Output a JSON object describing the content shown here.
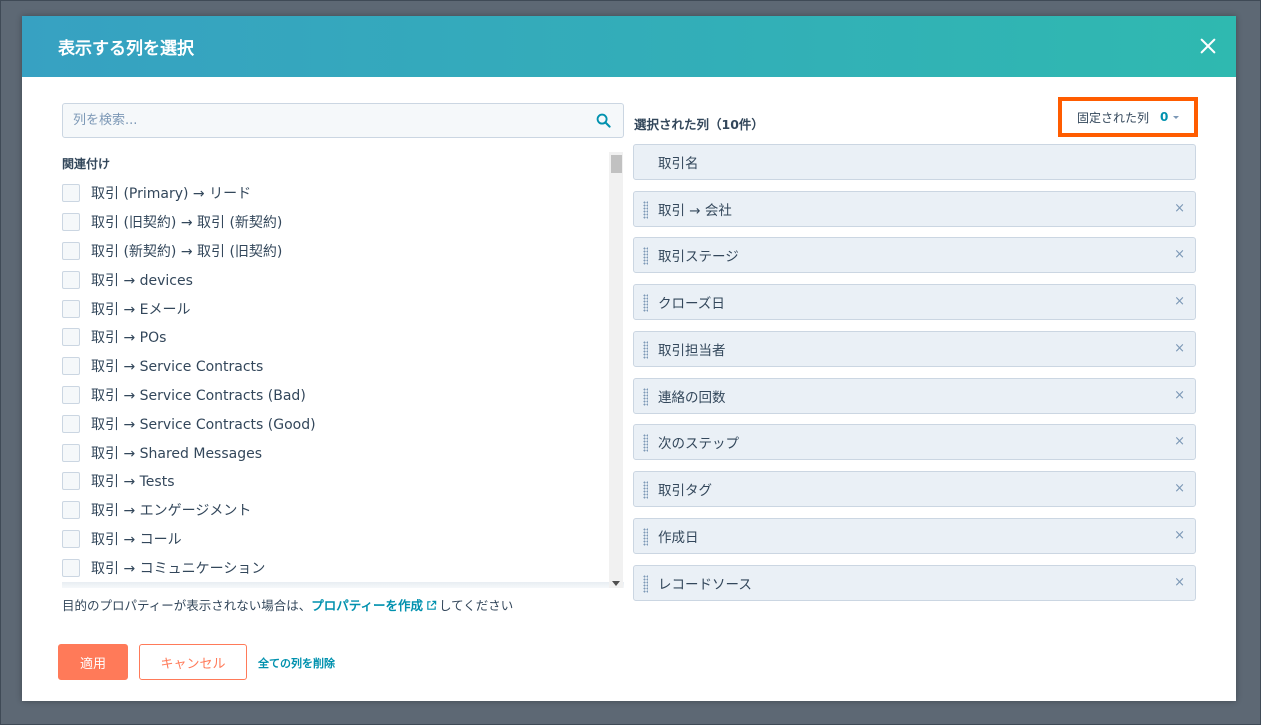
{
  "modal": {
    "title": "表示する列を選択"
  },
  "search": {
    "placeholder": "列を検索..."
  },
  "left_panel": {
    "group_label": "関連付け",
    "items": [
      "取引 (Primary) → リード",
      "取引 (旧契約) → 取引 (新契約)",
      "取引 (新契約) → 取引 (旧契約)",
      "取引 → devices",
      "取引 → Eメール",
      "取引 → POs",
      "取引 → Service Contracts",
      "取引 → Service Contracts (Bad)",
      "取引 → Service Contracts (Good)",
      "取引 → Shared Messages",
      "取引 → Tests",
      "取引 → エンゲージメント",
      "取引 → コール",
      "取引 → コミュニケーション"
    ],
    "hint_before": "目的のプロパティーが表示されない場合は、",
    "hint_link": "プロパティーを作成",
    "hint_after": "してください"
  },
  "right_panel": {
    "selected_title": "選択された列（10件）",
    "frozen_label": "固定された列",
    "frozen_count": "0",
    "columns": [
      "取引名",
      "取引 → 会社",
      "取引ステージ",
      "クローズ日",
      "取引担当者",
      "連絡の回数",
      "次のステップ",
      "取引タグ",
      "作成日",
      "レコードソース"
    ],
    "remove_symbol": "×"
  },
  "footer": {
    "apply_label": "適用",
    "cancel_label": "キャンセル",
    "clear_label": "全ての列を削除"
  },
  "colors": {
    "header_gradient_start": "#37a1c2",
    "header_gradient_end": "#2fb9b0",
    "primary_button": "#ff7a59",
    "link": "#0091ae",
    "highlight_border": "#ff5c00"
  }
}
